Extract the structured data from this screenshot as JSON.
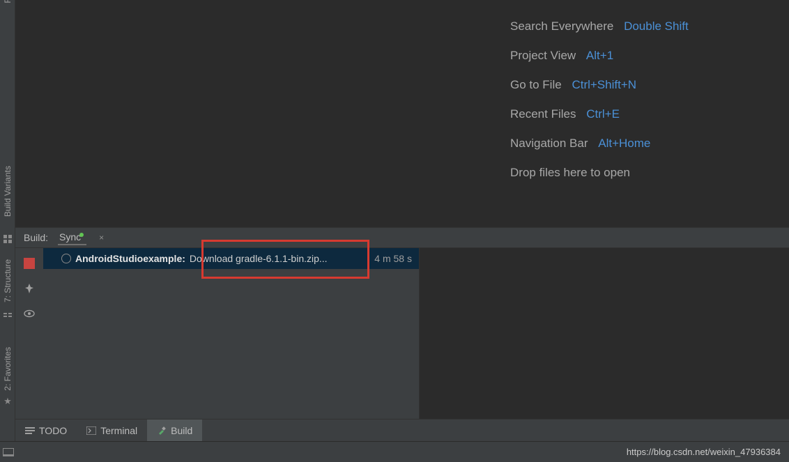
{
  "left_gutter": {
    "r_label": "R",
    "build_variants": "Build Variants",
    "structure": "7: Structure",
    "favorites": "2: Favorites"
  },
  "shortcuts": {
    "search_everywhere": {
      "label": "Search Everywhere",
      "key": "Double Shift"
    },
    "project_view": {
      "label": "Project View",
      "key": "Alt+1"
    },
    "go_to_file": {
      "label": "Go to File",
      "key": "Ctrl+Shift+N"
    },
    "recent_files": {
      "label": "Recent Files",
      "key": "Ctrl+E"
    },
    "navigation_bar": {
      "label": "Navigation Bar",
      "key": "Alt+Home"
    },
    "drop_hint": {
      "label": "Drop files here to open"
    }
  },
  "build_panel": {
    "title": "Build:",
    "tab_name": "Sync",
    "tab_close": "×",
    "project_name": "AndroidStudioexample:",
    "task_text": "Download gradle-6.1.1-bin.zip...",
    "elapsed": "4 m 58 s"
  },
  "bottom_tools": {
    "todo": "TODO",
    "terminal": "Terminal",
    "build": "Build"
  },
  "status_bar": {
    "url": "https://blog.csdn.net/weixin_47936384"
  }
}
